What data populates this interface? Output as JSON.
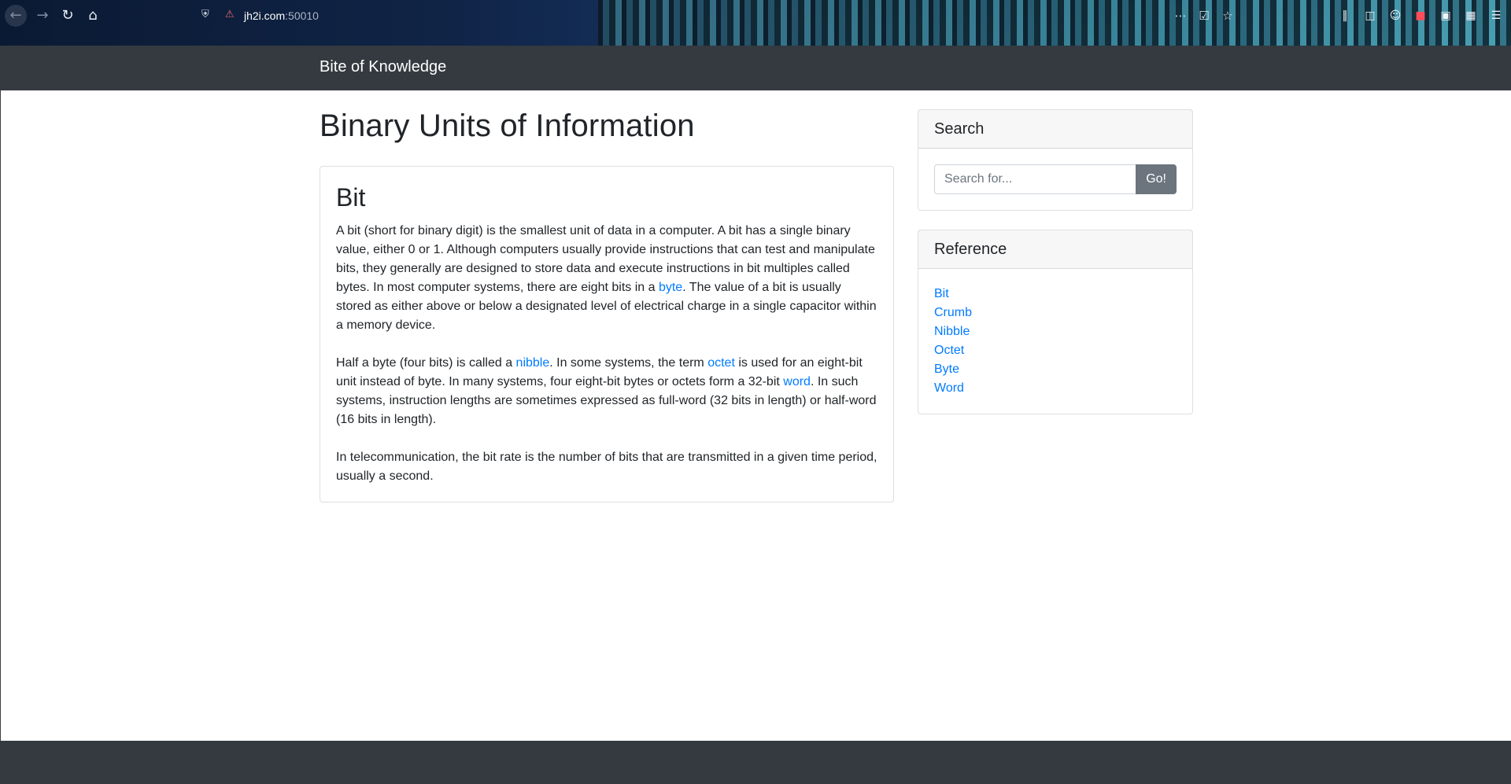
{
  "browser": {
    "url_host": "jh2i.com",
    "url_port": ":50010",
    "icons": {
      "back": "back-arrow-icon",
      "forward": "forward-arrow-icon",
      "reload": "reload-icon",
      "home": "home-icon",
      "page_actions": "more-icon",
      "pocket": "pocket-icon",
      "bookmark": "star-icon",
      "library": "library-icon",
      "sidebar": "sidebar-icon",
      "account": "account-icon",
      "extensions": [
        "red-extension-icon",
        "s-extension-icon",
        "extensions-icon"
      ],
      "menu": "hamburger-menu-icon"
    }
  },
  "navbar": {
    "brand": "Bite of Knowledge"
  },
  "main": {
    "title": "Binary Units of Information",
    "article": {
      "title": "Bit",
      "p1_a": "A bit (short for binary digit) is the smallest unit of data in a computer. A bit has a single binary value, either 0 or 1. Although computers usually provide instructions that can test and manipulate bits, they generally are designed to store data and execute instructions in bit multiples called bytes. In most computer systems, there are eight bits in a ",
      "p1_link": "byte",
      "p1_b": ". The value of a bit is usually stored as either above or below a designated level of electrical charge in a single capacitor within a memory device.",
      "p2_a": "Half a byte (four bits) is called a ",
      "p2_link1": "nibble",
      "p2_b": ". In some systems, the term ",
      "p2_link2": "octet",
      "p2_c": " is used for an eight-bit unit instead of byte. In many systems, four eight-bit bytes or octets form a 32-bit ",
      "p2_link3": "word",
      "p2_d": ". In such systems, instruction lengths are sometimes expressed as full-word (32 bits in length) or half-word (16 bits in length).",
      "p3": "In telecommunication, the bit rate is the number of bits that are transmitted in a given time period, usually a second."
    }
  },
  "sidebar": {
    "search": {
      "header": "Search",
      "placeholder": "Search for...",
      "value": "",
      "button": "Go!"
    },
    "reference": {
      "header": "Reference",
      "items": [
        "Bit",
        "Crumb",
        "Nibble",
        "Octet",
        "Byte",
        "Word"
      ]
    }
  },
  "colors": {
    "navbar_bg": "#343a40",
    "link": "#007bff",
    "button_secondary": "#6c757d"
  }
}
